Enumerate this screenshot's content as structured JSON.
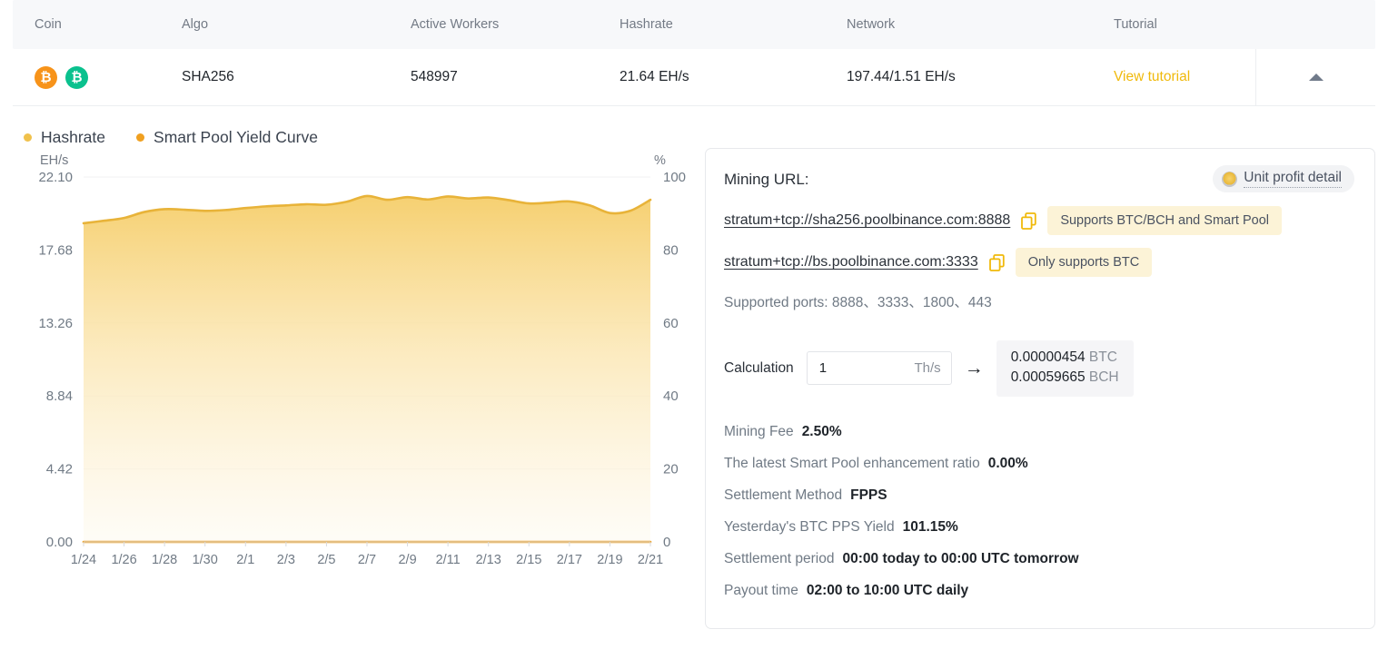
{
  "table": {
    "headers": [
      "Coin",
      "Algo",
      "Active Workers",
      "Hashrate",
      "Network",
      "Tutorial"
    ],
    "row": {
      "coin_icons": [
        {
          "name": "btc-coin-icon",
          "symbol": "₿",
          "color": "#f7931a"
        },
        {
          "name": "bch-coin-icon",
          "symbol": "₿",
          "color": "#0ac18e"
        }
      ],
      "algo": "SHA256",
      "active_workers": "548997",
      "hashrate": "21.64 EH/s",
      "network": "197.44/1.51 EH/s",
      "tutorial_link": "View tutorial",
      "expand_icon": "caret-up-icon"
    }
  },
  "legend": [
    {
      "label": "Hashrate",
      "color": "#f0c14b"
    },
    {
      "label": "Smart Pool Yield Curve",
      "color": "#f0a020"
    }
  ],
  "chart_data": {
    "type": "area",
    "title": "",
    "xlabel": "",
    "ylabel": "EH/s",
    "y2label": "%",
    "ylim": [
      0,
      22.1
    ],
    "y2lim": [
      0,
      100
    ],
    "yticks": [
      "0.00",
      "4.42",
      "8.84",
      "13.26",
      "17.68",
      "22.10"
    ],
    "y2ticks": [
      "0",
      "20",
      "40",
      "60",
      "80",
      "100"
    ],
    "grid": true,
    "legend_position": "above-left",
    "x": [
      "1/24",
      "1/25",
      "1/26",
      "1/27",
      "1/28",
      "1/29",
      "1/30",
      "1/31",
      "2/1",
      "2/2",
      "2/3",
      "2/4",
      "2/5",
      "2/6",
      "2/7",
      "2/8",
      "2/9",
      "2/10",
      "2/11",
      "2/12",
      "2/13",
      "2/14",
      "2/15",
      "2/16",
      "2/17",
      "2/18",
      "2/19",
      "2/20",
      "2/21"
    ],
    "xticks": [
      "1/24",
      "1/26",
      "1/28",
      "1/30",
      "2/1",
      "2/3",
      "2/5",
      "2/7",
      "2/9",
      "2/11",
      "2/13",
      "2/15",
      "2/17",
      "2/19",
      "2/21"
    ],
    "series": [
      {
        "name": "Hashrate",
        "axis": "left",
        "unit": "EH/s",
        "color": "#e8b339",
        "fill": "#f7d98a",
        "values": [
          19.3,
          19.45,
          19.62,
          19.98,
          20.15,
          20.12,
          20.05,
          20.1,
          20.22,
          20.32,
          20.38,
          20.45,
          20.42,
          20.6,
          20.95,
          20.72,
          20.88,
          20.74,
          20.92,
          20.8,
          20.86,
          20.7,
          20.5,
          20.55,
          20.62,
          20.38,
          19.92,
          20.05,
          20.72
        ]
      },
      {
        "name": "Smart Pool Yield Curve",
        "axis": "right",
        "unit": "%",
        "color": "#f0a020",
        "values": [
          0,
          0,
          0,
          0,
          0,
          0,
          0,
          0,
          0,
          0,
          0,
          0,
          0,
          0,
          0,
          0,
          0,
          0,
          0,
          0,
          0,
          0,
          0,
          0,
          0,
          0,
          0,
          0,
          0
        ]
      }
    ]
  },
  "panel": {
    "mining_url_title": "Mining URL:",
    "unit_profit": {
      "icon": "coin-icon",
      "label": "Unit profit detail"
    },
    "urls": [
      {
        "url": "stratum+tcp://sha256.poolbinance.com:8888",
        "tag": "Supports BTC/BCH and Smart Pool",
        "copy_icon": "copy-icon"
      },
      {
        "url": "stratum+tcp://bs.poolbinance.com:3333",
        "tag": "Only supports BTC",
        "copy_icon": "copy-icon"
      }
    ],
    "supported_ports": "Supported ports: 8888、3333、1800、443",
    "calculation": {
      "label": "Calculation",
      "input_value": "1",
      "input_placeholder": "1",
      "unit": "Th/s",
      "arrow": "→",
      "results": [
        {
          "value": "0.00000454",
          "unit": "BTC"
        },
        {
          "value": "0.00059665",
          "unit": "BCH"
        }
      ]
    },
    "stats": [
      {
        "label": "Mining Fee",
        "value": "2.50%"
      },
      {
        "label": "The latest Smart Pool enhancement ratio",
        "value": "0.00%"
      },
      {
        "label": "Settlement Method",
        "value": "FPPS"
      },
      {
        "label": "Yesterday's BTC PPS Yield",
        "value": "101.15%"
      },
      {
        "label": "Settlement period",
        "value": "00:00 today to 00:00 UTC tomorrow"
      },
      {
        "label": "Payout time",
        "value": "02:00 to 10:00 UTC daily"
      }
    ]
  },
  "colors": {
    "accent": "#f0b90b",
    "hashrate_line": "#e8b339",
    "yield_line": "#f0a020",
    "btc": "#f7931a",
    "bch": "#0ac18e"
  }
}
